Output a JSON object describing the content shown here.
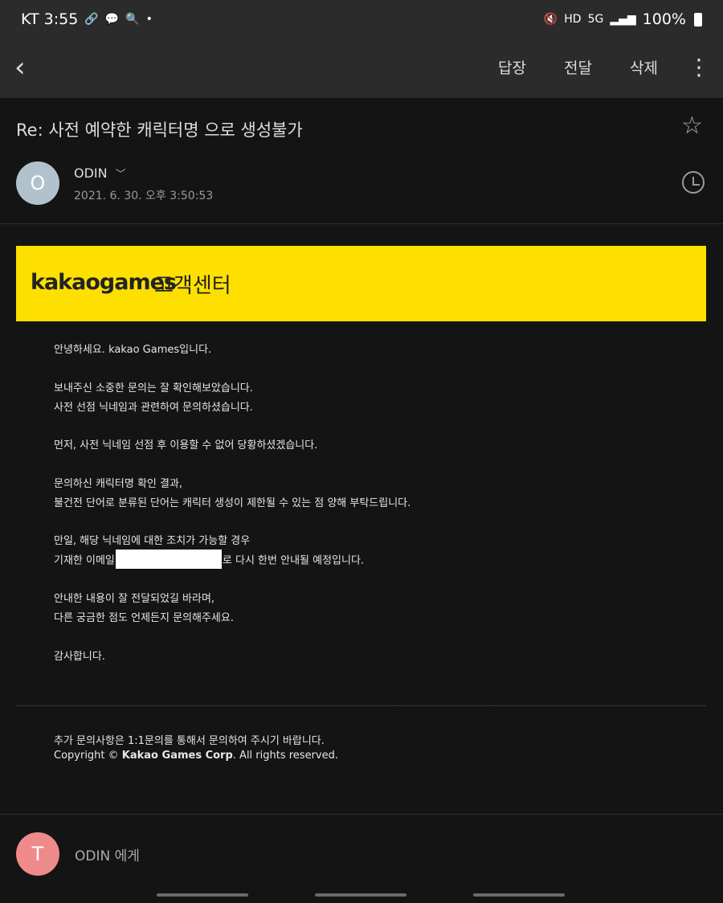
{
  "status_bar": {
    "carrier_time": "KT 3:55",
    "left_icons": [
      "link-icon",
      "talk-icon",
      "gallery-search-icon"
    ],
    "dot": "•",
    "right_icons": [
      "mute-icon",
      "hd-icon",
      "5g-icon",
      "signal-icon"
    ],
    "battery": "100%"
  },
  "toolbar": {
    "back_icon": "back-icon",
    "reply": "답장",
    "forward": "전달",
    "delete": "삭제",
    "more": "⋮"
  },
  "email": {
    "subject": "Re: 사전 예약한 캐릭터명 으로 생성불가",
    "sender_initial": "O",
    "sender": "ODIN",
    "date": "2021. 6. 30. 오후 3:50:53",
    "avatar_color": "#b2c2cc"
  },
  "banner": {
    "brand": "kakaogames",
    "subtitle": "고객센터",
    "color": "#fde000"
  },
  "body": {
    "l1": "안녕하세요. kakao Games입니다.",
    "l2": "보내주신 소중한 문의는 잘 확인해보았습니다.",
    "l3": "사전 선점 닉네임과 관련하여 문의하셨습니다.",
    "l4": "먼저, 사전 닉네임 선점 후 이용할 수 없어 당황하셨겠습니다.",
    "l5": "문의하신 캐릭터명 확인 결과,",
    "l6": "불건전 단어로 분류된 단어는 캐릭터 생성이 제한될 수 있는 점 양해 부탁드립니다.",
    "l7": "만일, 해당 닉네임에 대한 조치가 가능할 경우",
    "l8_pre": "기재한 이메일",
    "l8_post": "로 다시 한번 안내될 예정입니다.",
    "l9": "안내한 내용이 잘 전달되었길 바라며,",
    "l10": "다른 궁금한 점도 언제든지 문의해주세요.",
    "l11": "감사합니다."
  },
  "footer": {
    "note": "추가 문의사항은 1:1문의를 통해서 문의하여 주시기 바랍니다.",
    "copyright_prefix": "Copyright © ",
    "copyright_company": "Kakao Games Corp",
    "copyright_suffix": ". All rights reserved."
  },
  "reply_bar": {
    "initial": "T",
    "to": "ODIN 에게",
    "avatar_color": "#ef8a8a"
  }
}
